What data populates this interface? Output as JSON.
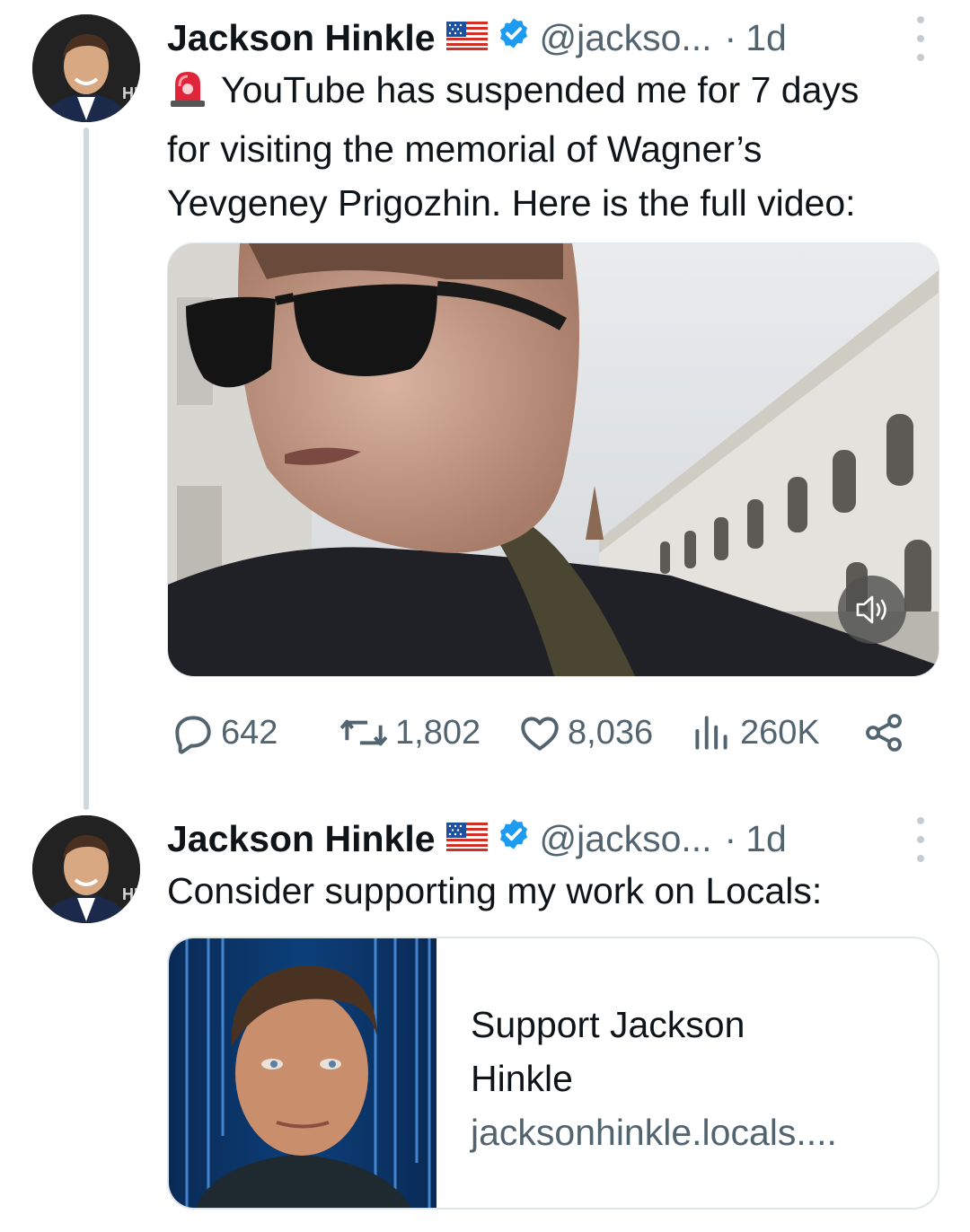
{
  "tweets": [
    {
      "author_name": "Jackson Hinkle",
      "flag_icon": "us-flag-icon",
      "verified_icon": "verified-badge-icon",
      "handle": "@jackso...",
      "dot": "·",
      "time": "1d",
      "text_lines": [
        "YouTube has suspended me for 7 days",
        "for visiting the memorial of Wagner’s",
        "Yevgeney Prigozhin. Here is the full video:"
      ],
      "emoji_icon": "police-siren-icon",
      "media": {
        "type": "video",
        "muted_icon": "speaker-muted-icon"
      },
      "stats": {
        "replies": "642",
        "reposts": "1,802",
        "likes": "8,036",
        "views": "260K"
      }
    },
    {
      "author_name": "Jackson Hinkle",
      "flag_icon": "us-flag-icon",
      "verified_icon": "verified-badge-icon",
      "handle": "@jackso...",
      "dot": "·",
      "time": "1d",
      "text": "Consider supporting my work on Locals:",
      "card": {
        "title_lines": [
          "Support Jackson",
          "Hinkle"
        ],
        "domain": "jacksonhinkle.locals...."
      }
    }
  ],
  "colors": {
    "text_primary": "#0f1419",
    "text_secondary": "#536471",
    "verified_blue": "#1d9bf0",
    "thread_line": "#cfd9de"
  }
}
